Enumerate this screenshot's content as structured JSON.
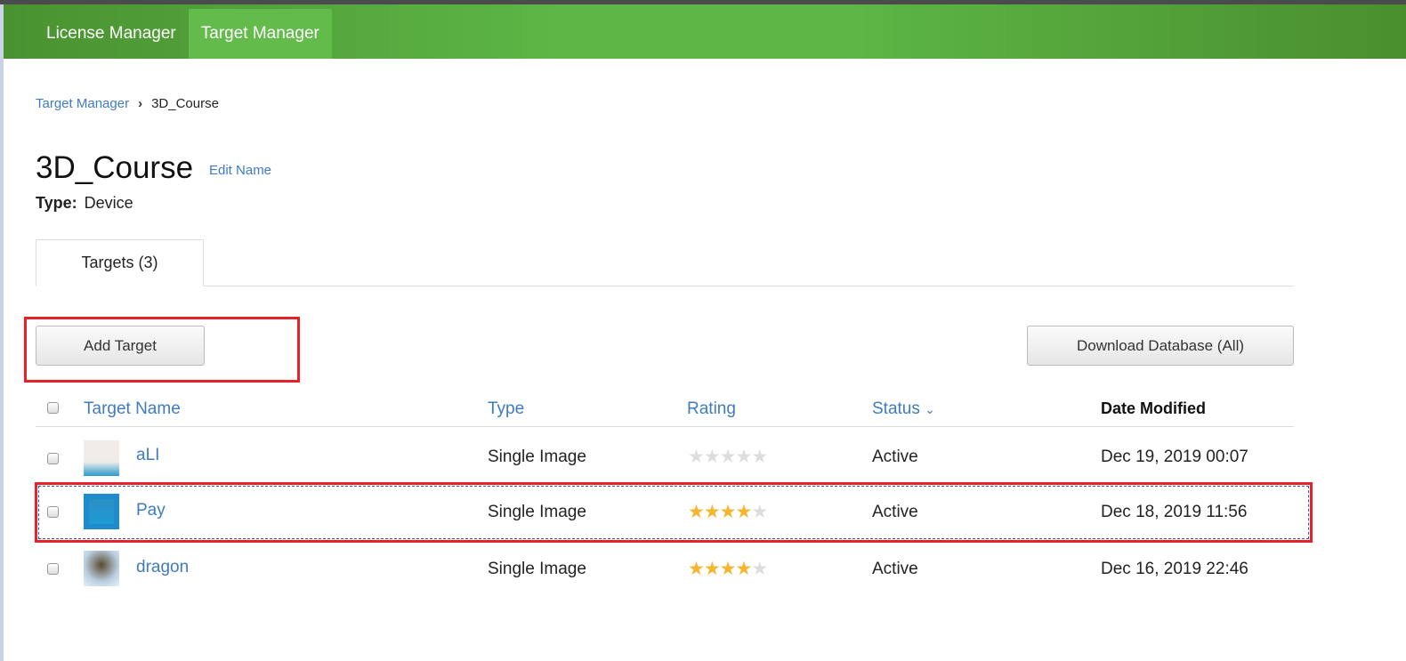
{
  "nav": {
    "items": [
      {
        "label": "License Manager"
      },
      {
        "label": "Target Manager"
      }
    ]
  },
  "breadcrumb": {
    "root": "Target Manager",
    "current": "3D_Course"
  },
  "title": "3D_Course",
  "edit_name": "Edit Name",
  "type": {
    "label": "Type:",
    "value": "Device"
  },
  "tab": "Targets (3)",
  "buttons": {
    "add": "Add Target",
    "download": "Download Database (All)"
  },
  "columns": {
    "name": "Target Name",
    "type": "Type",
    "rating": "Rating",
    "status": "Status",
    "date": "Date Modified"
  },
  "rows": [
    {
      "name": "aLI",
      "type": "Single Image",
      "rating": 0,
      "status": "Active",
      "date": "Dec 19, 2019 00:07"
    },
    {
      "name": "Pay",
      "type": "Single Image",
      "rating": 4,
      "status": "Active",
      "date": "Dec 18, 2019 11:56"
    },
    {
      "name": "dragon",
      "type": "Single Image",
      "rating": 4,
      "status": "Active",
      "date": "Dec 16, 2019 22:46"
    }
  ]
}
